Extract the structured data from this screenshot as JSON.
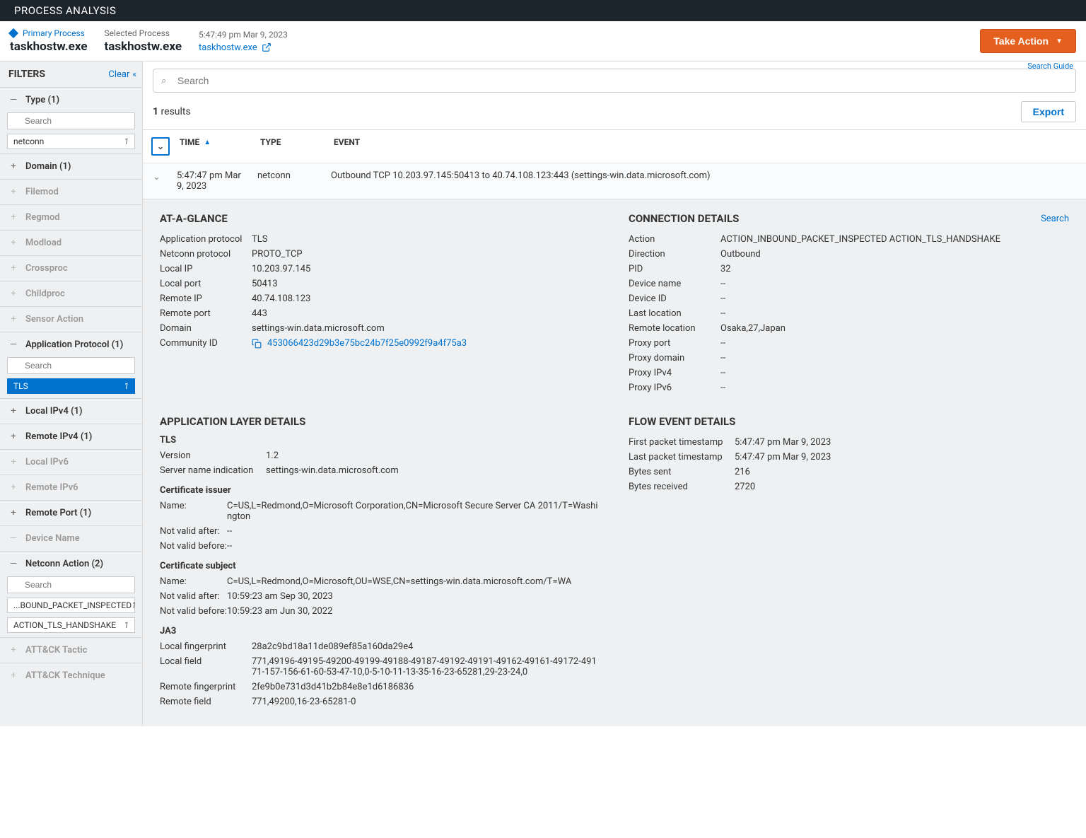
{
  "topbar": {
    "title": "PROCESS ANALYSIS"
  },
  "header": {
    "primary_label": "Primary Process",
    "primary_value": "taskhostw.exe",
    "selected_label": "Selected Process",
    "selected_value": "taskhostw.exe",
    "timestamp": "5:47:49 pm Mar 9, 2023",
    "link_text": "taskhostw.exe",
    "take_action": "Take Action"
  },
  "sidebar": {
    "title": "FILTERS",
    "clear": "Clear",
    "search_placeholder": "Search",
    "facets": {
      "type": {
        "label": "Type (1)",
        "open": true,
        "items": [
          {
            "label": "netconn",
            "count": "1",
            "selected": false
          }
        ]
      },
      "domain": {
        "label": "Domain (1)"
      },
      "filemod": {
        "label": "Filemod"
      },
      "regmod": {
        "label": "Regmod"
      },
      "modload": {
        "label": "Modload"
      },
      "crossproc": {
        "label": "Crossproc"
      },
      "childproc": {
        "label": "Childproc"
      },
      "sensoraction": {
        "label": "Sensor Action"
      },
      "approtocol": {
        "label": "Application Protocol (1)",
        "items": [
          {
            "label": "TLS",
            "count": "1",
            "selected": true
          }
        ]
      },
      "localipv4": {
        "label": "Local IPv4 (1)"
      },
      "remoteipv4": {
        "label": "Remote IPv4 (1)"
      },
      "localipv6": {
        "label": "Local IPv6"
      },
      "remoteipv6": {
        "label": "Remote IPv6"
      },
      "remoteport": {
        "label": "Remote Port (1)"
      },
      "devicename": {
        "label": "Device Name"
      },
      "netconnaction": {
        "label": "Netconn Action (2)",
        "items": [
          {
            "label": "...BOUND_PACKET_INSPECTED",
            "count": "1",
            "selected": false
          },
          {
            "label": "ACTION_TLS_HANDSHAKE",
            "count": "1",
            "selected": false
          }
        ]
      },
      "attack_tactic": {
        "label": "ATT&CK Tactic"
      },
      "attack_technique": {
        "label": "ATT&CK Technique"
      }
    }
  },
  "search": {
    "guide": "Search Guide",
    "placeholder": "Search"
  },
  "results": {
    "count": "1",
    "label": "results",
    "export": "Export",
    "columns": {
      "time": "TIME",
      "type": "TYPE",
      "event": "EVENT"
    },
    "row": {
      "time": "5:47:47 pm Mar 9, 2023",
      "type": "netconn",
      "event": "Outbound TCP 10.203.97.145:50413 to 40.74.108.123:443 (settings-win.data.microsoft.com)"
    }
  },
  "glance": {
    "title": "AT-A-GLANCE",
    "approtocol_k": "Application protocol",
    "approtocol_v": "TLS",
    "netconnproto_k": "Netconn protocol",
    "netconnproto_v": "PROTO_TCP",
    "localip_k": "Local IP",
    "localip_v": "10.203.97.145",
    "localport_k": "Local port",
    "localport_v": "50413",
    "remoteip_k": "Remote IP",
    "remoteip_v": "40.74.108.123",
    "remoteport_k": "Remote port",
    "remoteport_v": "443",
    "domain_k": "Domain",
    "domain_v": "settings-win.data.microsoft.com",
    "community_k": "Community ID",
    "community_v": "453066423d29b3e75bc24b7f25e0992f9a4f75a3"
  },
  "conn": {
    "title": "CONNECTION DETAILS",
    "search": "Search",
    "action_k": "Action",
    "action_v": "ACTION_INBOUND_PACKET_INSPECTED ACTION_TLS_HANDSHAKE",
    "direction_k": "Direction",
    "direction_v": "Outbound",
    "pid_k": "PID",
    "pid_v": "32",
    "devname_k": "Device name",
    "devname_v": "--",
    "devid_k": "Device ID",
    "devid_v": "--",
    "lastloc_k": "Last location",
    "lastloc_v": "--",
    "remoteloc_k": "Remote location",
    "remoteloc_v": "Osaka,27,Japan",
    "proxyport_k": "Proxy port",
    "proxyport_v": "--",
    "proxydom_k": "Proxy domain",
    "proxydom_v": "--",
    "proxyipv4_k": "Proxy IPv4",
    "proxyipv4_v": "--",
    "proxyipv6_k": "Proxy IPv6",
    "proxyipv6_v": "--"
  },
  "app": {
    "title": "APPLICATION LAYER DETAILS",
    "tls": "TLS",
    "version_k": "Version",
    "version_v": "1.2",
    "sni_k": "Server name indication",
    "sni_v": "settings-win.data.microsoft.com",
    "issuer": "Certificate issuer",
    "issuer_name_k": "Name:",
    "issuer_name_v": "C=US,L=Redmond,O=Microsoft Corporation,CN=Microsoft Secure Server CA 2011/T=Washington",
    "issuer_nva_k": "Not valid after:",
    "issuer_nva_v": "--",
    "issuer_nvb_k": "Not valid before:",
    "issuer_nvb_v": "--",
    "subject": "Certificate subject",
    "subject_name_k": "Name:",
    "subject_name_v": "C=US,L=Redmond,O=Microsoft,OU=WSE,CN=settings-win.data.microsoft.com/T=WA",
    "subject_nva_k": "Not valid after:",
    "subject_nva_v": "10:59:23 am Sep 30, 2023",
    "subject_nvb_k": "Not valid before:",
    "subject_nvb_v": "10:59:23 am Jun 30, 2022",
    "ja3": "JA3",
    "lfp_k": "Local fingerprint",
    "lfp_v": "28a2c9bd18a11de089ef85a160da29e4",
    "lfield_k": "Local field",
    "lfield_v": "771,49196-49195-49200-49199-49188-49187-49192-49191-49162-49161-49172-49171-157-156-61-60-53-47-10,0-5-10-11-13-35-16-23-65281,29-23-24,0",
    "rfp_k": "Remote fingerprint",
    "rfp_v": "2fe9b0e731d3d41b2b84e8e1d6186836",
    "rfield_k": "Remote field",
    "rfield_v": "771,49200,16-23-65281-0"
  },
  "flow": {
    "title": "FLOW EVENT DETAILS",
    "first_k": "First packet timestamp",
    "first_v": "5:47:47 pm Mar 9, 2023",
    "last_k": "Last packet timestamp",
    "last_v": "5:47:47 pm Mar 9, 2023",
    "sent_k": "Bytes sent",
    "sent_v": "216",
    "recv_k": "Bytes received",
    "recv_v": "2720"
  }
}
